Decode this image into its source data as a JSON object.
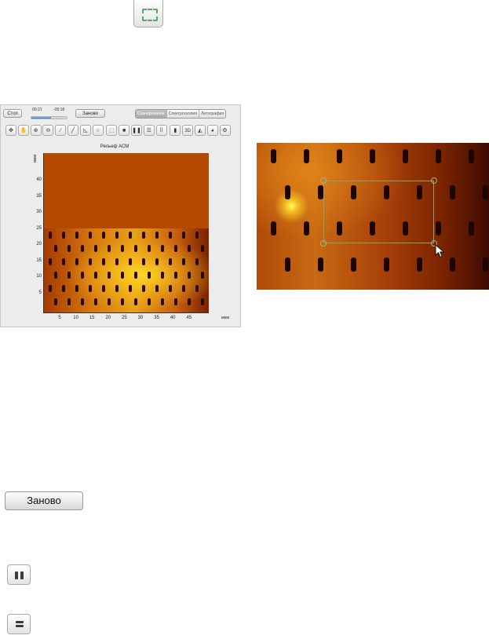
{
  "controls": {
    "stop_label": "Стоп",
    "restart_label": "Заново",
    "elapsed": "00:21",
    "remaining": "-00:18",
    "progress_fraction": 0.55
  },
  "modes": {
    "tabs": [
      {
        "label": "Сканирование",
        "active": true
      },
      {
        "label": "Спектроскопия",
        "active": false
      },
      {
        "label": "Литография",
        "active": false
      }
    ]
  },
  "toolbar": {
    "tools": [
      {
        "name": "move-icon",
        "glyph": "✥"
      },
      {
        "name": "hand-icon",
        "glyph": "✋"
      },
      {
        "name": "zoom-in-icon",
        "glyph": "⊕"
      },
      {
        "name": "zoom-out-icon",
        "glyph": "⊖"
      },
      {
        "name": "eyedropper-icon",
        "glyph": "⁄"
      },
      {
        "name": "ruler-icon",
        "glyph": "╱"
      },
      {
        "name": "angle-icon",
        "glyph": "◺"
      },
      {
        "name": "circle-select-icon",
        "glyph": "○"
      },
      {
        "name": "rect-select-icon",
        "glyph": "⬚"
      },
      {
        "name": "stop-icon",
        "glyph": "■"
      },
      {
        "name": "pause-icon",
        "glyph": "❚❚"
      },
      {
        "name": "lines-icon",
        "glyph": "☰"
      },
      {
        "name": "grid-icon",
        "glyph": "⠿"
      },
      {
        "name": "color-bar-icon",
        "glyph": "▮"
      },
      {
        "name": "view-3d-label",
        "glyph": "3D"
      },
      {
        "name": "filter-icon",
        "glyph": "◭"
      },
      {
        "name": "palette-icon",
        "glyph": "◕"
      },
      {
        "name": "settings-gear-icon",
        "glyph": "⚙"
      }
    ]
  },
  "plot": {
    "title": "Рельеф АСМ",
    "y_unit": "мкм",
    "x_unit": "мкм",
    "y_ticks": [
      "40",
      "35",
      "30",
      "25",
      "20",
      "15",
      "10",
      "5"
    ],
    "x_ticks": [
      "5",
      "10",
      "15",
      "20",
      "25",
      "30",
      "35",
      "40",
      "45"
    ],
    "colors": {
      "unscanned": "#b34a00",
      "bright": "#ffe028",
      "dark": "#2a0a00"
    }
  },
  "buttons": {
    "restart_label": "Заново"
  }
}
